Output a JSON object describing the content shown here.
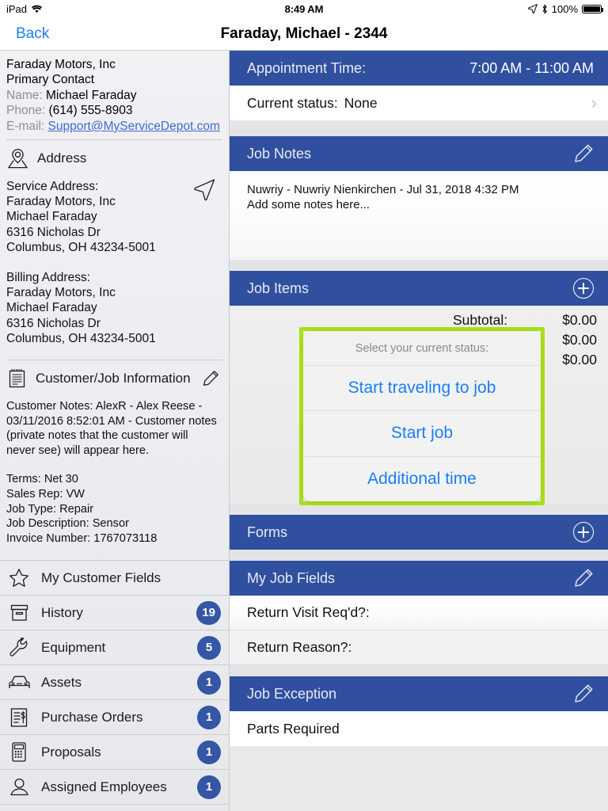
{
  "status_bar": {
    "device": "iPad",
    "wifi_icon": "wifi-icon",
    "time": "8:49 AM",
    "location_icon": "location-arrow-icon",
    "bluetooth_icon": "bluetooth-icon",
    "battery_percent": "100%"
  },
  "nav": {
    "back_label": "Back",
    "title": "Faraday, Michael - 2344"
  },
  "sidebar": {
    "company": "Faraday Motors, Inc",
    "contact_heading": "Primary Contact",
    "name_label": "Name:",
    "name_value": "Michael Faraday",
    "phone_label": "Phone:",
    "phone_value": "(614) 555-8903",
    "email_label": "E-mail:",
    "email_value": "Support@MyServiceDepot.com",
    "address_section_title": "Address",
    "service_address": {
      "heading": "Service Address:",
      "lines": [
        "Faraday Motors, Inc",
        "Michael Faraday",
        "6316 Nicholas Dr",
        "Columbus, OH  43234-5001"
      ]
    },
    "billing_address": {
      "heading": "Billing Address:",
      "lines": [
        "Faraday Motors, Inc",
        "Michael Faraday",
        "6316 Nicholas Dr",
        "Columbus, OH  43234-5001"
      ]
    },
    "customer_job_section_title": "Customer/Job Information",
    "customer_notes": "Customer Notes: AlexR - Alex Reese - 03/11/2016 8:52:01 AM - Customer notes (private notes that the customer will never see) will appear here.",
    "job_meta": [
      "Terms: Net 30",
      "Sales Rep: VW",
      "Job Type: Repair",
      "Job Description: Sensor",
      "Invoice Number: 1767073118"
    ],
    "menu": [
      {
        "label": "My Customer Fields",
        "icon": "star-icon",
        "badge": ""
      },
      {
        "label": "History",
        "icon": "archive-box-icon",
        "badge": "19"
      },
      {
        "label": "Equipment",
        "icon": "wrench-icon",
        "badge": "5"
      },
      {
        "label": "Assets",
        "icon": "car-icon",
        "badge": "1"
      },
      {
        "label": "Purchase Orders",
        "icon": "invoice-dollar-icon",
        "badge": "1"
      },
      {
        "label": "Proposals",
        "icon": "calculator-icon",
        "badge": "1"
      },
      {
        "label": "Assigned Employees",
        "icon": "person-icon",
        "badge": "1"
      }
    ]
  },
  "main": {
    "appointment": {
      "title": "Appointment Time:",
      "value": "7:00 AM - 11:00 AM"
    },
    "current_status": {
      "label": "Current status:",
      "value": "None",
      "chevron": "chevron-right-icon"
    },
    "job_notes": {
      "title": "Job Notes",
      "edit_icon": "pencil-icon",
      "line1": "Nuwriy - Nuwriy Nienkirchen - Jul 31, 2018 4:32 PM",
      "line2": "Add some notes here..."
    },
    "job_items": {
      "title": "Job Items",
      "add_icon": "plus-circle-icon",
      "subtotal_label": "Subtotal:",
      "amounts": [
        "$0.00",
        "$0.00",
        "$0.00"
      ]
    },
    "action_sheet": {
      "prompt": "Select your current status:",
      "options": [
        "Start traveling to job",
        "Start job",
        "Additional time"
      ],
      "highlight_color": "#a9df17"
    },
    "forms": {
      "title": "Forms",
      "add_icon": "plus-circle-icon"
    },
    "my_job_fields": {
      "title": "My Job Fields",
      "edit_icon": "pencil-icon",
      "rows": [
        {
          "label": "Return Visit Req'd?:",
          "value": ""
        },
        {
          "label": "Return Reason?:",
          "value": ""
        }
      ]
    },
    "job_exception": {
      "title": "Job Exception",
      "edit_icon": "pencil-icon",
      "rows": [
        {
          "label": "Parts Required"
        }
      ]
    }
  },
  "colors": {
    "header_blue": "#30509f",
    "badge_blue": "#3456a5",
    "link_blue": "#1a7ef5",
    "highlight_green": "#a9df17"
  }
}
